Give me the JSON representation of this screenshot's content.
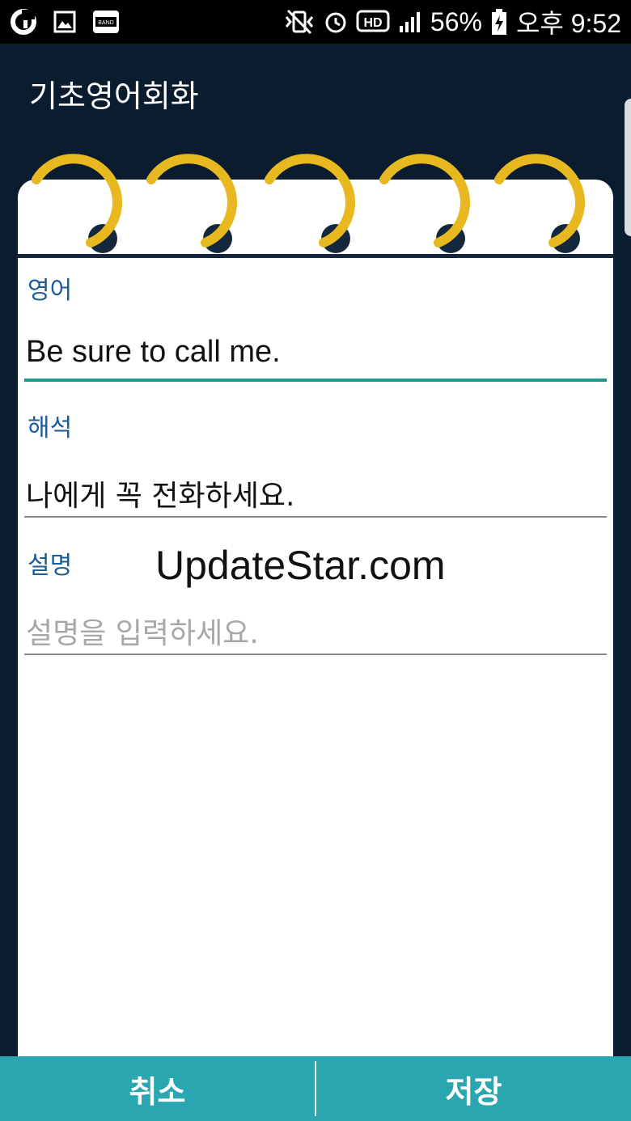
{
  "status_bar": {
    "left_icons": [
      "g-app-icon",
      "gallery-icon",
      "band-icon"
    ],
    "band_label": "BAND",
    "hd_label": "HD",
    "battery": "56%",
    "time": "오후 9:52"
  },
  "app": {
    "title": "기초영어회화"
  },
  "form": {
    "english": {
      "label": "영어",
      "value": "Be sure to call me."
    },
    "translation": {
      "label": "해석",
      "value": "나에게 꼭 전화하세요."
    },
    "description": {
      "label": "설명",
      "placeholder": "설명을 입력하세요."
    }
  },
  "watermark": "UpdateStar.com",
  "buttons": {
    "cancel": "취소",
    "save": "저장"
  },
  "colors": {
    "accent": "#2aa6b1",
    "label": "#1a5c9a",
    "ring": "#e8b820",
    "background": "#0b1c2e"
  }
}
